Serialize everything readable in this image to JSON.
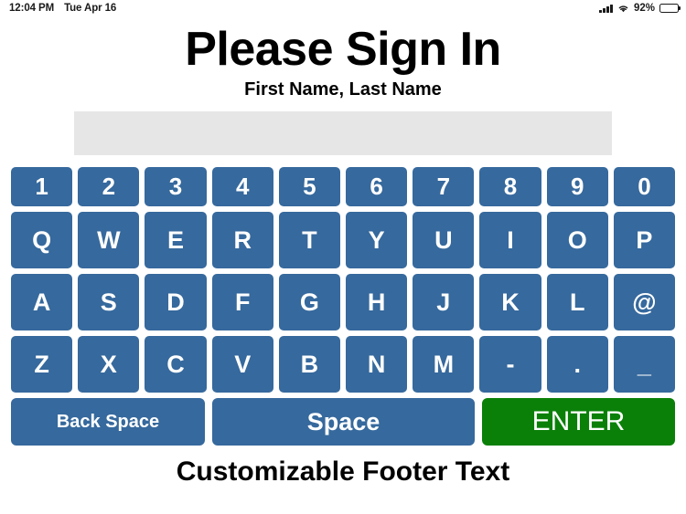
{
  "status_bar": {
    "time": "12:04 PM",
    "date": "Tue Apr 16",
    "battery_percent": "92%",
    "icons": {
      "signal": "signal-bars-icon",
      "wifi": "wifi-icon",
      "battery": "battery-icon"
    }
  },
  "header": {
    "title": "Please Sign In",
    "subtitle": "First Name, Last Name"
  },
  "input": {
    "value": "",
    "placeholder": ""
  },
  "keyboard": {
    "rows": [
      {
        "type": "number",
        "keys": [
          "1",
          "2",
          "3",
          "4",
          "5",
          "6",
          "7",
          "8",
          "9",
          "0"
        ]
      },
      {
        "type": "alpha",
        "keys": [
          "Q",
          "W",
          "E",
          "R",
          "T",
          "Y",
          "U",
          "I",
          "O",
          "P"
        ]
      },
      {
        "type": "alpha",
        "keys": [
          "A",
          "S",
          "D",
          "F",
          "G",
          "H",
          "J",
          "K",
          "L",
          "@"
        ]
      },
      {
        "type": "alpha",
        "keys": [
          "Z",
          "X",
          "C",
          "V",
          "B",
          "N",
          "M",
          "-",
          ".",
          "_"
        ]
      }
    ],
    "actions": {
      "backspace": "Back Space",
      "space": "Space",
      "enter": "ENTER"
    }
  },
  "footer": {
    "text": "Customizable Footer Text"
  },
  "colors": {
    "key_blue": "#36699d",
    "enter_green": "#0a8008",
    "input_background": "#e6e6e6",
    "page_background": "#ffffff"
  }
}
